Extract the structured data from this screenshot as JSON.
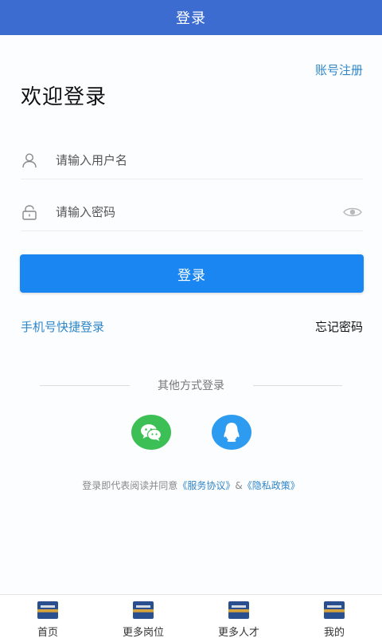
{
  "header": {
    "title": "登录"
  },
  "register_link": "账号注册",
  "welcome_title": "欢迎登录",
  "username_field": {
    "placeholder": "请输入用户名",
    "value": ""
  },
  "password_field": {
    "placeholder": "请输入密码",
    "value": ""
  },
  "login_button": "登录",
  "quick_login": "手机号快捷登录",
  "forgot_password": "忘记密码",
  "other_methods": {
    "label": "其他方式登录",
    "options": [
      {
        "name": "wechat",
        "icon": "wechat-icon",
        "color": "#3cbf54"
      },
      {
        "name": "qq",
        "icon": "qq-icon",
        "color": "#2d9cf0"
      }
    ]
  },
  "agreement": {
    "prefix": "登录即代表阅读并同意",
    "service_link": "《服务协议》",
    "joiner": "&",
    "privacy_link": "《隐私政策》"
  },
  "tabs": [
    {
      "label": "首页",
      "icon": "app-logo-icon"
    },
    {
      "label": "更多岗位",
      "icon": "app-logo-icon"
    },
    {
      "label": "更多人才",
      "icon": "app-logo-icon"
    },
    {
      "label": "我的",
      "icon": "app-logo-icon"
    }
  ],
  "colors": {
    "header_bg": "#3d6cd0",
    "primary_button": "#1a86f1",
    "link": "#2f86c9"
  }
}
